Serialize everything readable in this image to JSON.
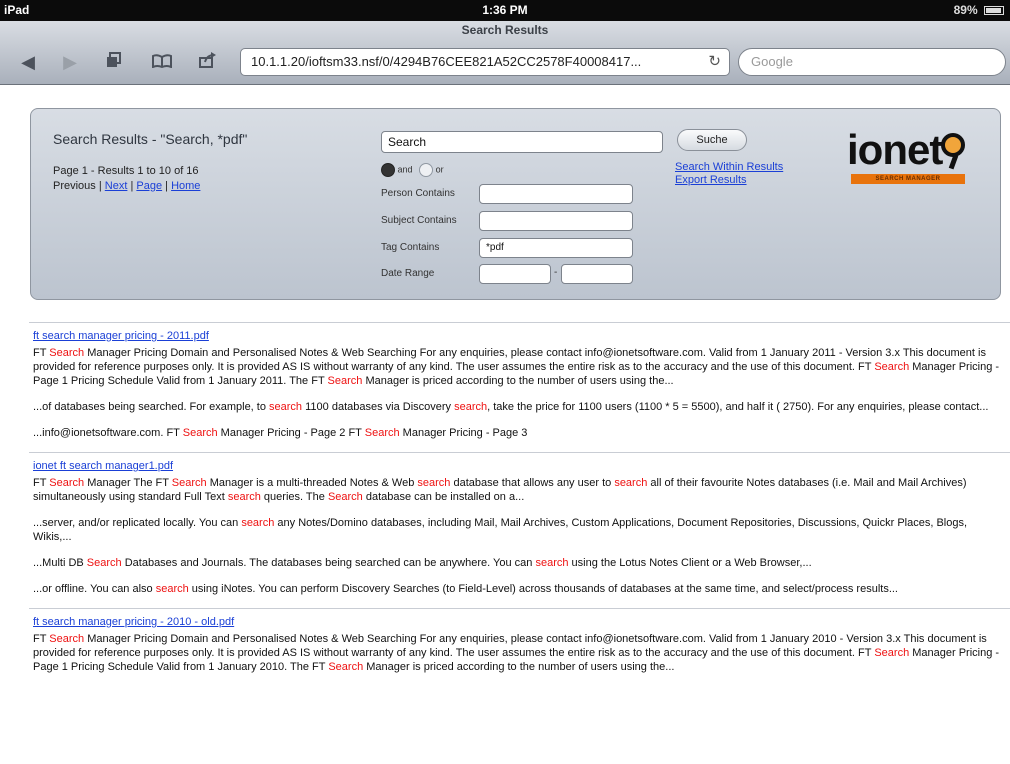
{
  "status": {
    "device": "iPad",
    "time": "1:36 PM",
    "battery": "89%"
  },
  "browser": {
    "title": "Search Results",
    "url": "10.1.1.20/ioftsm33.nsf/0/4294B76CEE821A52CC2578F40008417...",
    "search_placeholder": "Google"
  },
  "panel": {
    "title": "Search Results - \"Search, *pdf\"",
    "page_info": "Page 1 - Results 1 to 10 of 16",
    "nav_prefix": "Previous | ",
    "nav": {
      "next": "Next",
      "page": "Page",
      "home": "Home"
    },
    "search_value": "Search",
    "search_button": "Suche",
    "radio_and": "and",
    "radio_or": "or",
    "person_label": "Person Contains",
    "subject_label": "Subject Contains",
    "tag_label": "Tag Contains",
    "tag_value": "*pdf",
    "date_label": "Date Range",
    "within_link": "Search Within Results",
    "export_link": "Export Results",
    "logo_text": "ionet",
    "logo_tag": "SEARCH MANAGER"
  },
  "results": [
    {
      "title": "ft search manager pricing - 2011.pdf",
      "snippets": [
        [
          "FT ",
          {
            "h": "Search"
          },
          " Manager Pricing Domain and Personalised Notes & Web Searching For any enquiries, please contact info@ionetsoftware.com. Valid from 1 January 2011 - Version 3.x This document is provided for reference purposes only. It is provided AS IS without warranty of any kind. The user assumes the entire risk as to the accuracy and the use of this document. FT ",
          {
            "h": "Search"
          },
          " Manager Pricing - Page 1 Pricing Schedule Valid from 1 January 2011. The FT ",
          {
            "h": "Search"
          },
          " Manager is priced according to the number of users using the..."
        ],
        [
          "...of databases being searched. For example, to ",
          {
            "h": "search"
          },
          " 1100 databases via Discovery ",
          {
            "h": "search"
          },
          ", take the price for 1100 users (1100 * 5 = 5500), and half it ( 2750). For any enquiries, please contact..."
        ],
        [
          "...info@ionetsoftware.com. FT ",
          {
            "h": "Search"
          },
          " Manager Pricing - Page 2 FT ",
          {
            "h": "Search"
          },
          " Manager Pricing - Page 3"
        ]
      ]
    },
    {
      "title": "ionet ft search manager1.pdf",
      "snippets": [
        [
          "FT ",
          {
            "h": "Search"
          },
          " Manager The FT ",
          {
            "h": "Search"
          },
          " Manager is a multi-threaded Notes & Web ",
          {
            "h": "search"
          },
          " database that allows any user to ",
          {
            "h": "search"
          },
          " all of their favourite Notes databases (i.e. Mail and Mail Archives) simultaneously using standard Full Text ",
          {
            "h": "search"
          },
          " queries. The ",
          {
            "h": "Search"
          },
          " database can be installed on a..."
        ],
        [
          "...server, and/or replicated locally. You can ",
          {
            "h": "search"
          },
          " any Notes/Domino databases, including Mail, Mail Archives, Custom Applications, Document Repositories, Discussions, Quickr Places, Blogs, Wikis,..."
        ],
        [
          "...Multi DB ",
          {
            "h": "Search"
          },
          " Databases and Journals. The databases being searched can be anywhere. You can ",
          {
            "h": "search"
          },
          " using the Lotus Notes Client or a Web Browser,..."
        ],
        [
          "...or offline. You can also ",
          {
            "h": "search"
          },
          " using iNotes. You can perform Discovery Searches (to Field-Level) across thousands of databases at the same time, and select/process results..."
        ]
      ]
    },
    {
      "title": "ft search manager pricing - 2010 - old.pdf",
      "snippets": [
        [
          "FT ",
          {
            "h": "Search"
          },
          " Manager Pricing Domain and Personalised Notes & Web Searching For any enquiries, please contact info@ionetsoftware.com. Valid from 1 January 2010 - Version 3.x This document is provided for reference purposes only. It is provided AS IS without warranty of any kind. The user assumes the entire risk as to the accuracy and the use of this document. FT ",
          {
            "h": "Search"
          },
          " Manager Pricing - Page 1 Pricing Schedule Valid from 1 January 2010. The FT ",
          {
            "h": "Search"
          },
          " Manager is priced according to the number of users using the..."
        ]
      ]
    }
  ]
}
